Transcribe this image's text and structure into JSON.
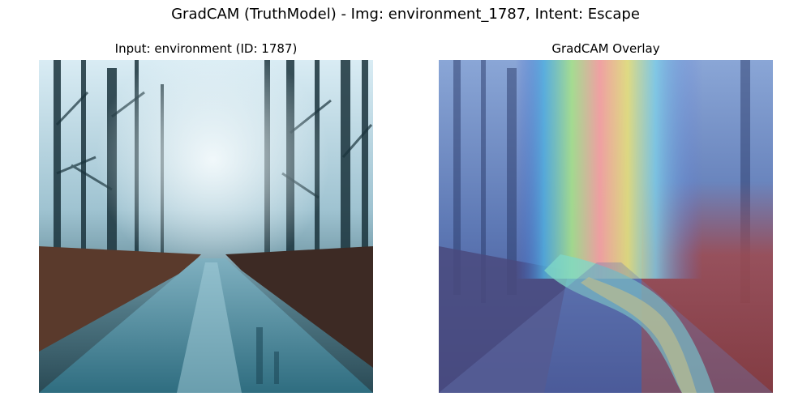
{
  "figure": {
    "title": "GradCAM (TruthModel) - Img: environment_1787, Intent: Escape"
  },
  "panels": [
    {
      "title": "Input: environment (ID: 1787)"
    },
    {
      "title": "GradCAM Overlay"
    }
  ],
  "scene": {
    "sky_color": "#e6f2f8",
    "fog_color": "#a9c9d6",
    "tree_color": "#1f3a44",
    "foliage_color": "#5a3a2a",
    "road_color": "#4f8a9c",
    "road_dark_color": "#1e4a5a"
  },
  "heatmap": {
    "colormap": "jet",
    "opacity": 0.5
  }
}
